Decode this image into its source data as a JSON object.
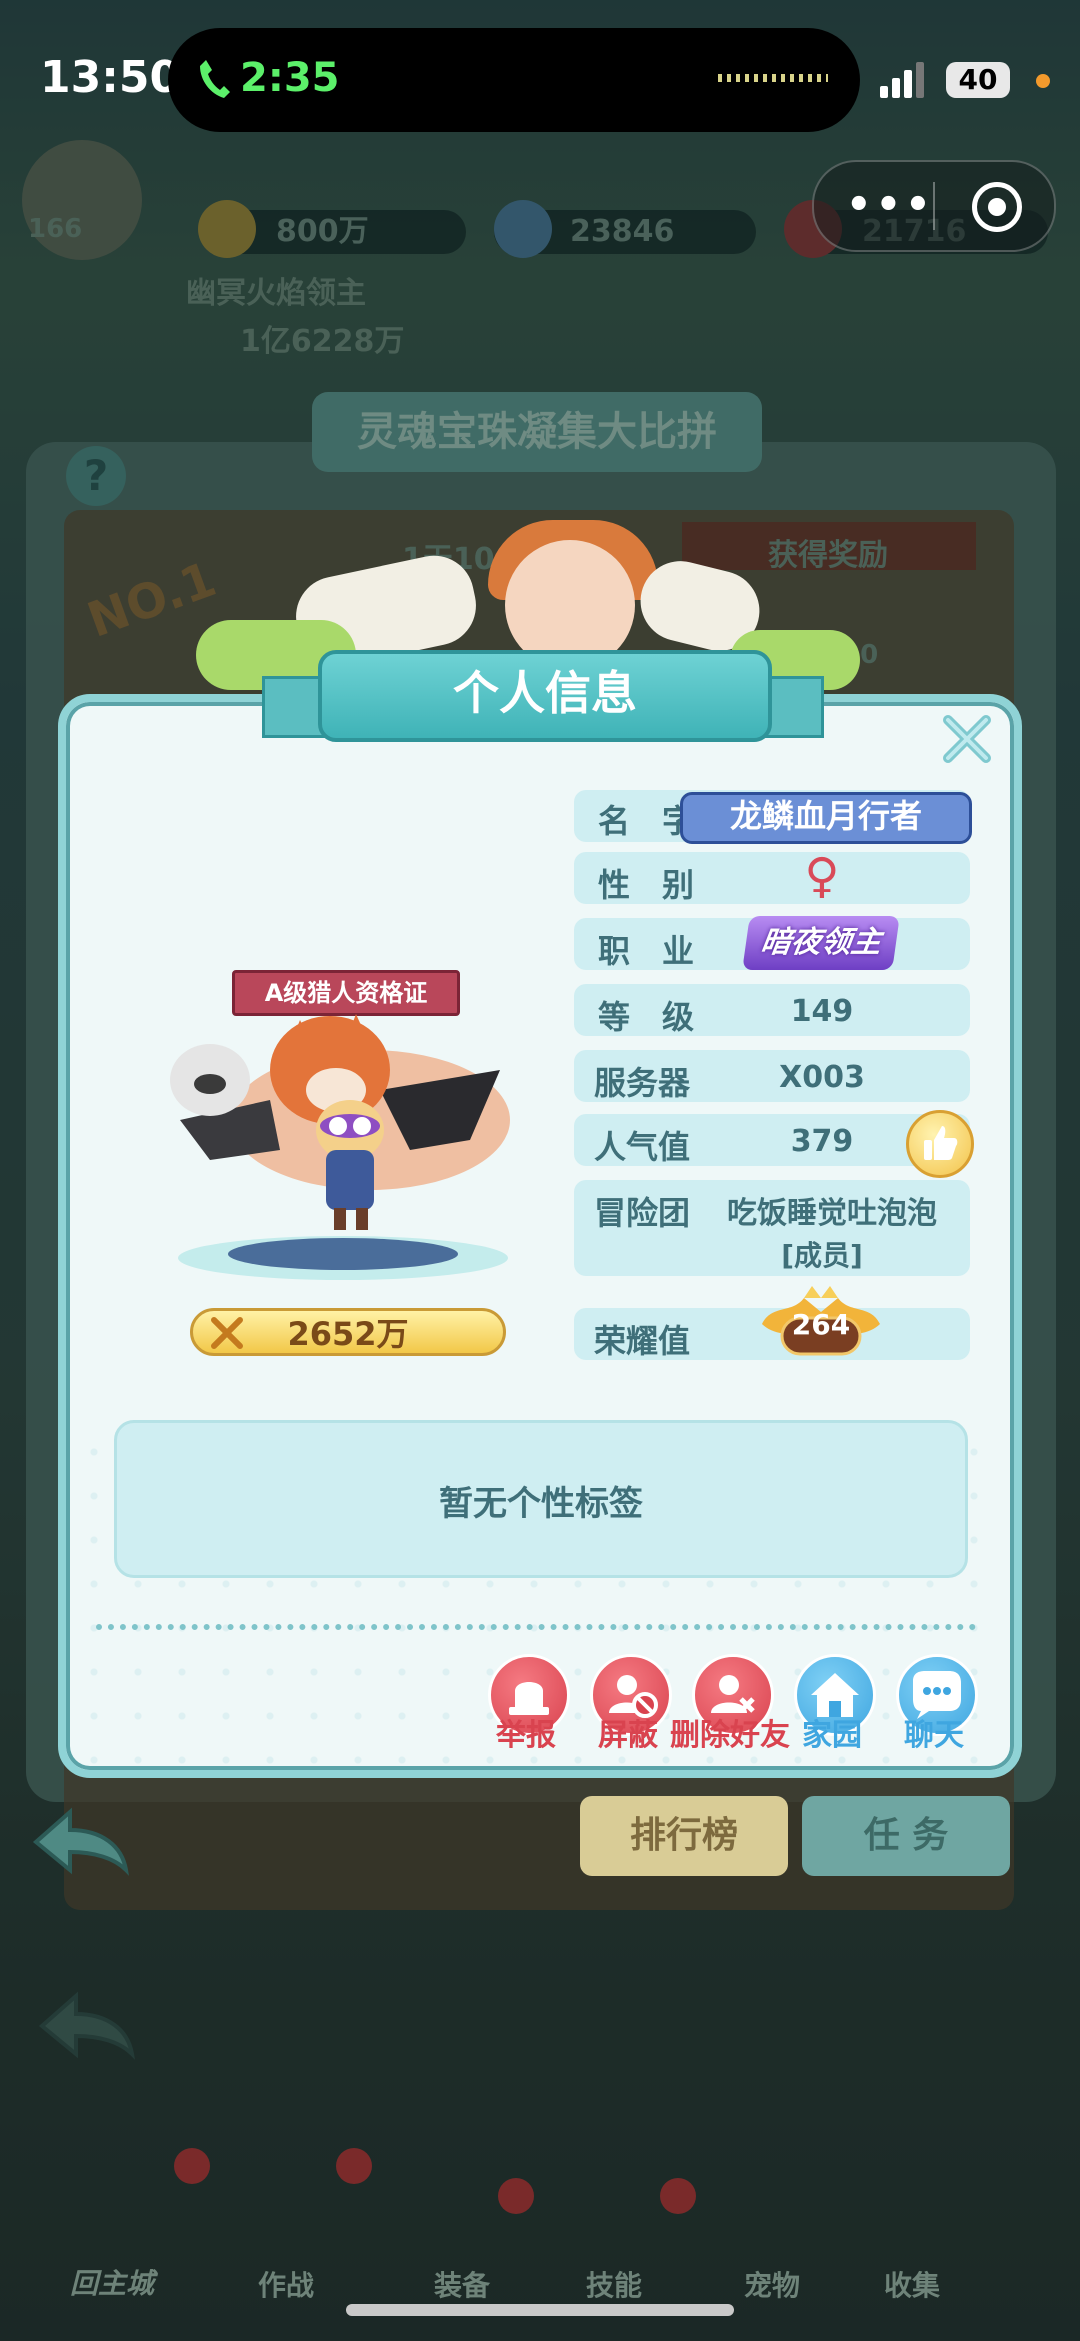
{
  "status_bar": {
    "time": "13:50",
    "call_duration": "2:35",
    "battery": "40"
  },
  "background": {
    "level": "166",
    "gold": "800万",
    "gems": "23846",
    "stamina": "21716",
    "player_title": "幽冥火焰领主",
    "combat_power": "1亿6228万",
    "event_title": "灵魂宝珠凝集大比拼",
    "rank_badge": "NO.1",
    "countdown": "1天10小时",
    "reward_label": "获得奖励",
    "reward_count": "120",
    "tabs": [
      "排行榜",
      "任 务"
    ],
    "bottom_nav": [
      "回主城",
      "作战",
      "装备",
      "技能",
      "宠物",
      "收集"
    ]
  },
  "profile": {
    "title": "个人信息",
    "certificate": "A级猎人资格证",
    "power": "2652万",
    "rows": {
      "name_label": "名　字",
      "name_value": "龙鳞血月行者",
      "gender_label": "性　别",
      "gender_value": "♀",
      "job_label": "职　业",
      "job_value": "暗夜领主",
      "level_label": "等　级",
      "level_value": "149",
      "server_label": "服务器",
      "server_value": "X003",
      "popularity_label": "人气值",
      "popularity_value": "379",
      "guild_label": "冒险团",
      "guild_value": "吃饭睡觉吐泡泡",
      "guild_role": "[成员]",
      "honor_label": "荣耀值",
      "honor_value": "264"
    },
    "tag_placeholder": "暂无个性标签",
    "actions": [
      "举报",
      "屏蔽",
      "删除好友",
      "家园",
      "聊天"
    ]
  },
  "colors": {
    "modal_bg": "#eff8f8",
    "teal": "#3fb3b7",
    "row_bg": "#cfeef2",
    "text": "#3f6f79",
    "action_red": "#d9434f",
    "action_blue": "#3fa6e0"
  }
}
